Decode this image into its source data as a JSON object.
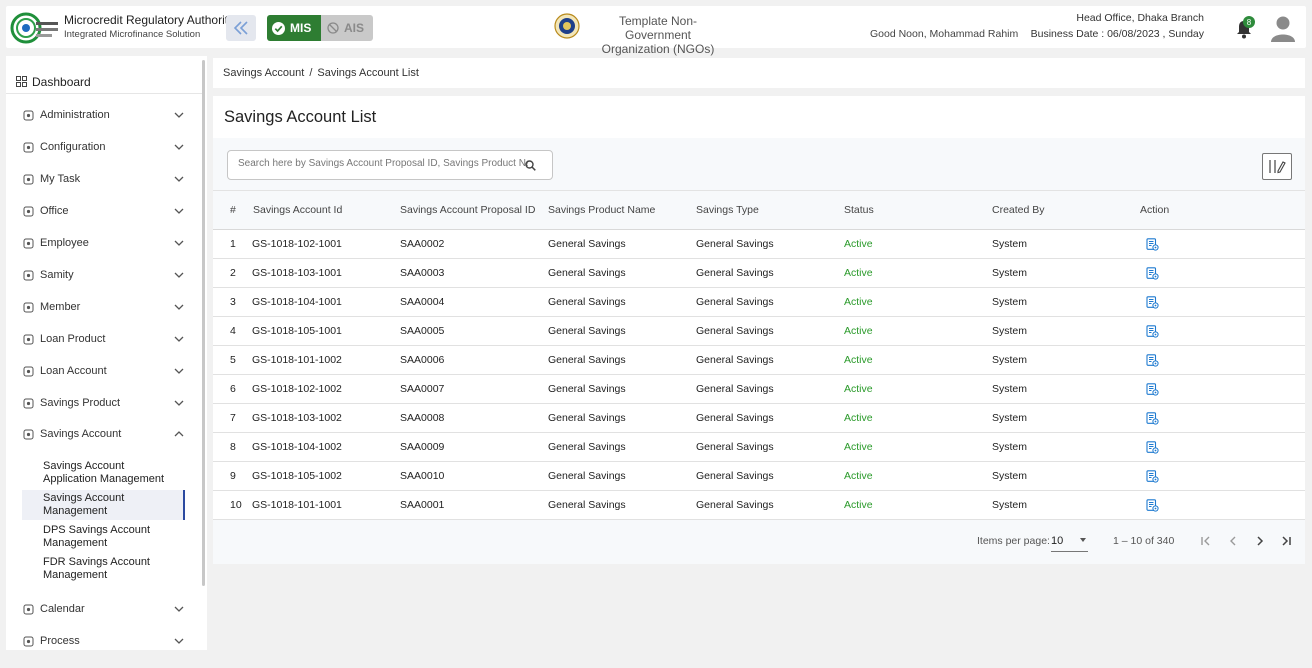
{
  "header": {
    "brand_title": "Microcredit Regulatory Authority",
    "brand_subtitle": "Integrated Microfinance Solution",
    "mis_label": "MIS",
    "ais_label": "AIS",
    "organization_line1": "Template Non-Government",
    "organization_line2": "Organization (NGOs)",
    "greeting": "Good Noon, Mohammad Rahim",
    "branch": "Head Office, Dhaka Branch",
    "business_date": "Business Date : 06/08/2023 , Sunday",
    "notification_count": "8",
    "colors": {
      "mis": "#2e7d32",
      "ais": "#c9c9c9",
      "badge": "#2e8b3b"
    }
  },
  "sidebar": {
    "dashboard_label": "Dashboard",
    "items": [
      {
        "label": "Administration",
        "icon": "admin-icon",
        "expanded": false
      },
      {
        "label": "Configuration",
        "icon": "config-icon",
        "expanded": false
      },
      {
        "label": "My Task",
        "icon": "task-icon",
        "expanded": false
      },
      {
        "label": "Office",
        "icon": "office-icon",
        "expanded": false
      },
      {
        "label": "Employee",
        "icon": "employee-icon",
        "expanded": false
      },
      {
        "label": "Samity",
        "icon": "samity-icon",
        "expanded": false
      },
      {
        "label": "Member",
        "icon": "member-icon",
        "expanded": false
      },
      {
        "label": "Loan Product",
        "icon": "loan-product-icon",
        "expanded": false
      },
      {
        "label": "Loan Account",
        "icon": "loan-account-icon",
        "expanded": false
      },
      {
        "label": "Savings Product",
        "icon": "savings-product-icon",
        "expanded": false
      },
      {
        "label": "Savings Account",
        "icon": "savings-account-icon",
        "expanded": true
      },
      {
        "label": "Calendar",
        "icon": "calendar-icon",
        "expanded": false
      },
      {
        "label": "Process",
        "icon": "process-icon",
        "expanded": false
      }
    ],
    "sub_items": [
      {
        "line1": "Savings Account",
        "line2": "Application Management",
        "active": false
      },
      {
        "line1": "Savings Account",
        "line2": "Management",
        "active": true
      },
      {
        "line1": "DPS Savings Account",
        "line2": "Management",
        "active": false
      },
      {
        "line1": "FDR Savings Account",
        "line2": "Management",
        "active": false
      }
    ]
  },
  "breadcrumb": {
    "parent": "Savings Account",
    "separator": "/",
    "current": "Savings Account List"
  },
  "page_title": "Savings Account List",
  "search": {
    "placeholder": "Search here by Savings Account Proposal ID, Savings Product Name, Savings Account ID",
    "value": ""
  },
  "table": {
    "headers": [
      "#",
      "Savings Account Id",
      "Savings Account Proposal ID",
      "Savings Product Name",
      "Savings Type",
      "Status",
      "Created By",
      "Action"
    ],
    "rows": [
      {
        "n": "1",
        "id": "GS-1018-102-1001",
        "proposal": "SAA0002",
        "product": "General Savings",
        "type": "General Savings",
        "status": "Active",
        "created_by": "System"
      },
      {
        "n": "2",
        "id": "GS-1018-103-1001",
        "proposal": "SAA0003",
        "product": "General Savings",
        "type": "General Savings",
        "status": "Active",
        "created_by": "System"
      },
      {
        "n": "3",
        "id": "GS-1018-104-1001",
        "proposal": "SAA0004",
        "product": "General Savings",
        "type": "General Savings",
        "status": "Active",
        "created_by": "System"
      },
      {
        "n": "4",
        "id": "GS-1018-105-1001",
        "proposal": "SAA0005",
        "product": "General Savings",
        "type": "General Savings",
        "status": "Active",
        "created_by": "System"
      },
      {
        "n": "5",
        "id": "GS-1018-101-1002",
        "proposal": "SAA0006",
        "product": "General Savings",
        "type": "General Savings",
        "status": "Active",
        "created_by": "System"
      },
      {
        "n": "6",
        "id": "GS-1018-102-1002",
        "proposal": "SAA0007",
        "product": "General Savings",
        "type": "General Savings",
        "status": "Active",
        "created_by": "System"
      },
      {
        "n": "7",
        "id": "GS-1018-103-1002",
        "proposal": "SAA0008",
        "product": "General Savings",
        "type": "General Savings",
        "status": "Active",
        "created_by": "System"
      },
      {
        "n": "8",
        "id": "GS-1018-104-1002",
        "proposal": "SAA0009",
        "product": "General Savings",
        "type": "General Savings",
        "status": "Active",
        "created_by": "System"
      },
      {
        "n": "9",
        "id": "GS-1018-105-1002",
        "proposal": "SAA0010",
        "product": "General Savings",
        "type": "General Savings",
        "status": "Active",
        "created_by": "System"
      },
      {
        "n": "10",
        "id": "GS-1018-101-1001",
        "proposal": "SAA0001",
        "product": "General Savings",
        "type": "General Savings",
        "status": "Active",
        "created_by": "System"
      }
    ],
    "status_color": "#2a9a2a",
    "action_icon": "view-details-icon"
  },
  "paginator": {
    "items_per_page_label": "Items per page:",
    "items_per_page": "10",
    "range": "1 – 10 of 340"
  }
}
